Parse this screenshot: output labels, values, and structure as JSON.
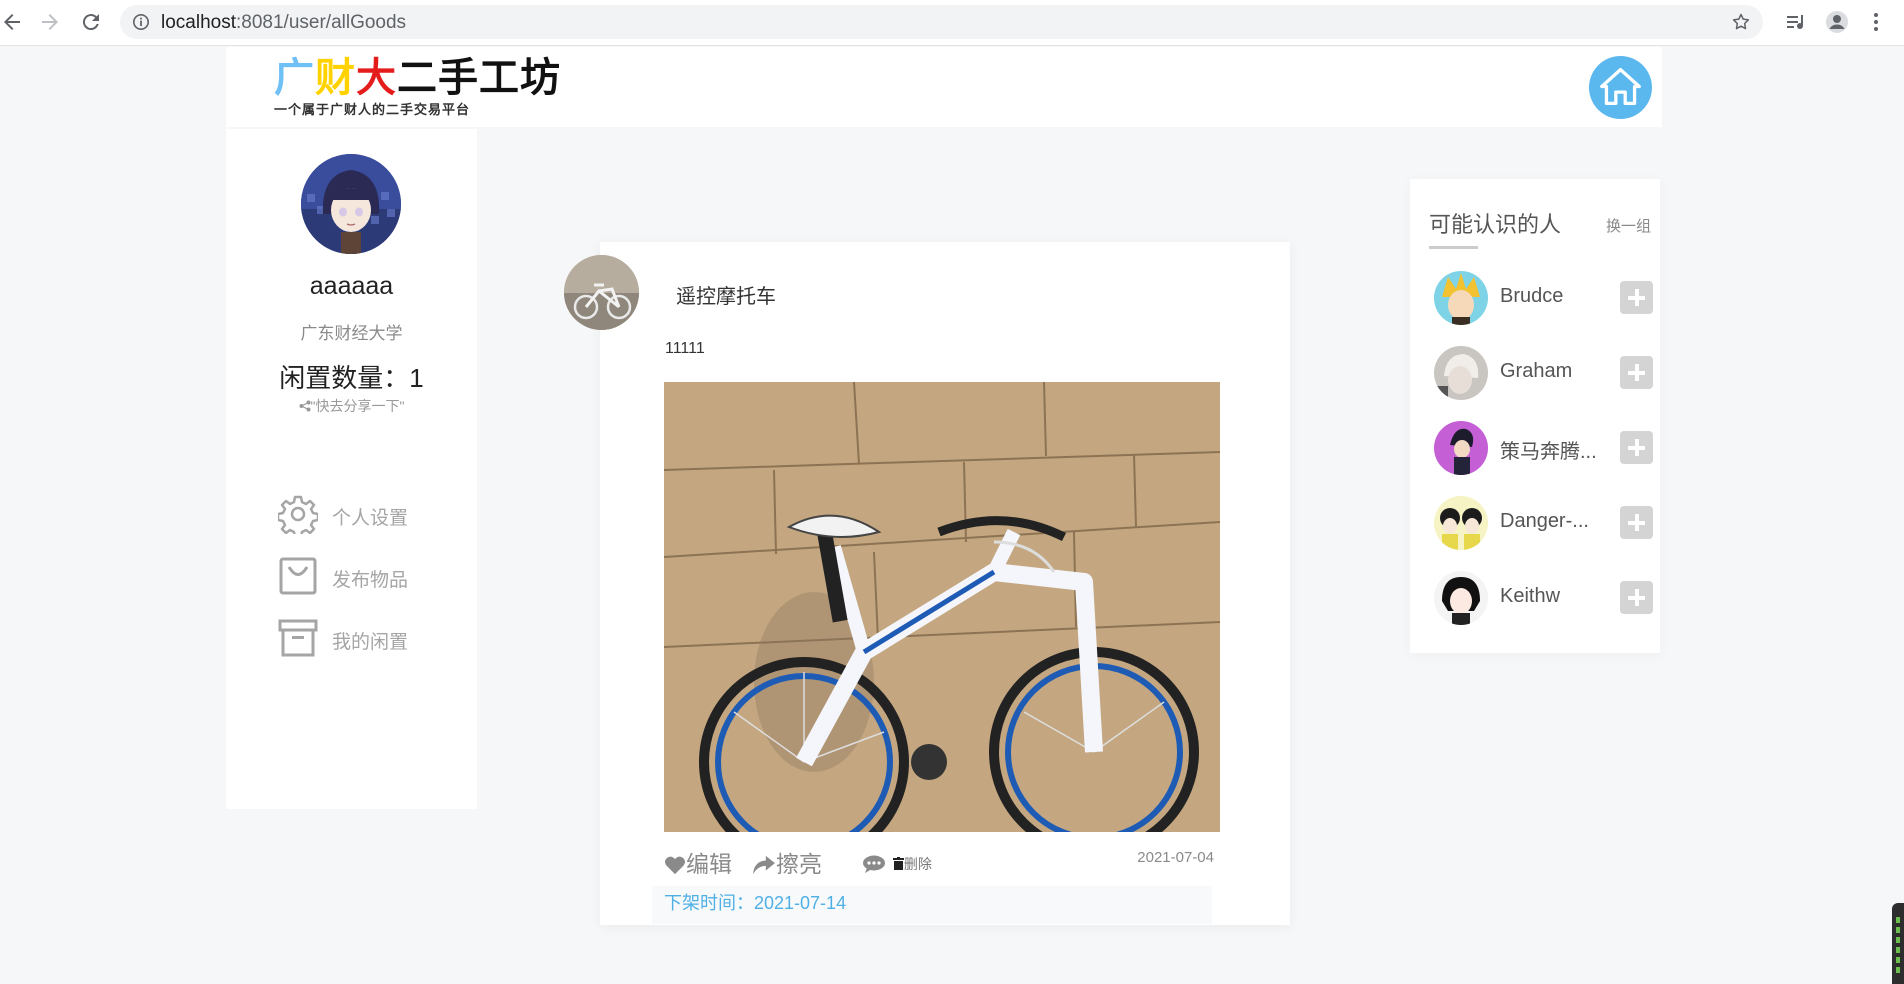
{
  "browser": {
    "url_host": "localhost",
    "url_rest": ":8081/user/allGoods"
  },
  "header": {
    "logo_chars": [
      "广",
      "财",
      "大",
      "二手工坊"
    ],
    "logo_subtitle": "一个属于广财人的二手交易平台"
  },
  "profile": {
    "username": "aaaaaa",
    "school": "广东财经大学",
    "idle_count": "闲置数量：1",
    "share": "\"快去分享一下\"",
    "menu": [
      {
        "label": "个人设置",
        "icon": "gear-icon"
      },
      {
        "label": "发布物品",
        "icon": "bag-icon"
      },
      {
        "label": "我的闲置",
        "icon": "archive-icon"
      }
    ]
  },
  "post": {
    "title": "遥控摩托车",
    "description": "11111",
    "actions": {
      "edit": "编辑",
      "refresh": "擦亮",
      "delete": "删除"
    },
    "date": "2021-07-04",
    "offshelf_label": "下架时间：",
    "offshelf_date": "2021-07-14"
  },
  "suggestions": {
    "title": "可能认识的人",
    "refresh_label": "换一组",
    "people": [
      {
        "name": "Brudce"
      },
      {
        "name": "Graham"
      },
      {
        "name": "策马奔腾..."
      },
      {
        "name": "Danger-..."
      },
      {
        "name": "Keithw"
      }
    ]
  },
  "colors": {
    "accent_blue": "#5bb8ef",
    "link_blue": "#4fb0e6",
    "logo_blue": "#6fc0f5",
    "logo_yellow": "#ffd200",
    "logo_red": "#e51c1c"
  }
}
